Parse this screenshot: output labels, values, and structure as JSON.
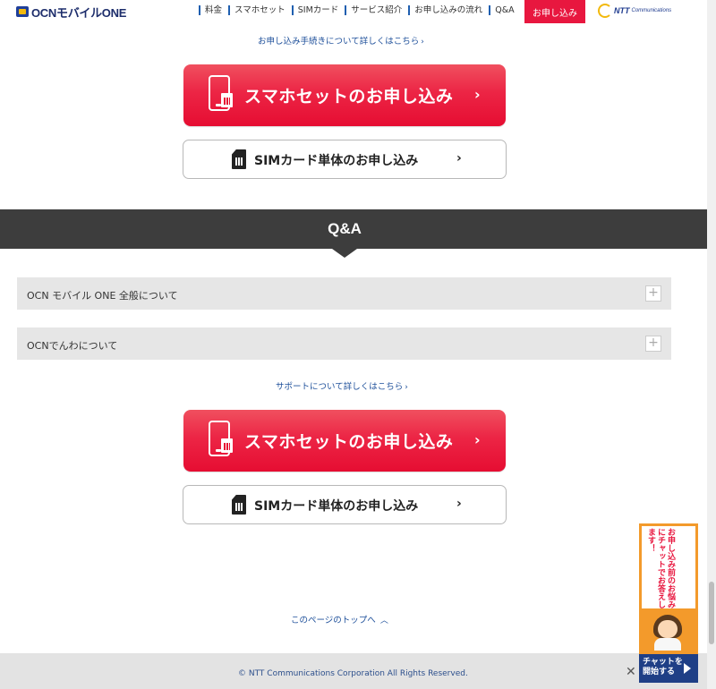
{
  "header": {
    "logo_text": "OCNモバイルONE",
    "nav": [
      "料金",
      "スマホセット",
      "SIMカード",
      "サービス紹介",
      "お申し込みの流れ",
      "Q&A"
    ],
    "apply_label": "お申し込み",
    "ntt_text": "NTT",
    "ntt_sub": "Communications"
  },
  "top": {
    "procedure_link": "お申し込み手続きについて詳しくはこちら",
    "smartphone_button": "スマホセットのお申し込み",
    "sim_button": "SIMカード単体のお申し込み"
  },
  "qa": {
    "title": "Q&A",
    "items": [
      "OCN モバイル ONE 全般について",
      "OCNでんわについて"
    ],
    "support_link": "サポートについて詳しくはこちら"
  },
  "bottom": {
    "smartphone_button": "スマホセットのお申し込み",
    "sim_button": "SIMカード単体のお申し込み",
    "page_top_link": "このページのトップへ"
  },
  "footer": {
    "copyright": "© NTT Communications Corporation All Rights Reserved."
  },
  "chat": {
    "message": "お申し込み前のお悩みにチャットでお答えします！",
    "button_line1": "チャットを",
    "button_line2": "開始する"
  },
  "colors": {
    "accent_red": "#e8173f",
    "band_dark": "#3d3d3d",
    "link_blue": "#1d4f9a",
    "chat_orange": "#f39a2b",
    "chat_navy": "#1f3f86"
  },
  "icons": {
    "chevron": "›",
    "plus": "+",
    "close": "✕",
    "up": "︿"
  }
}
